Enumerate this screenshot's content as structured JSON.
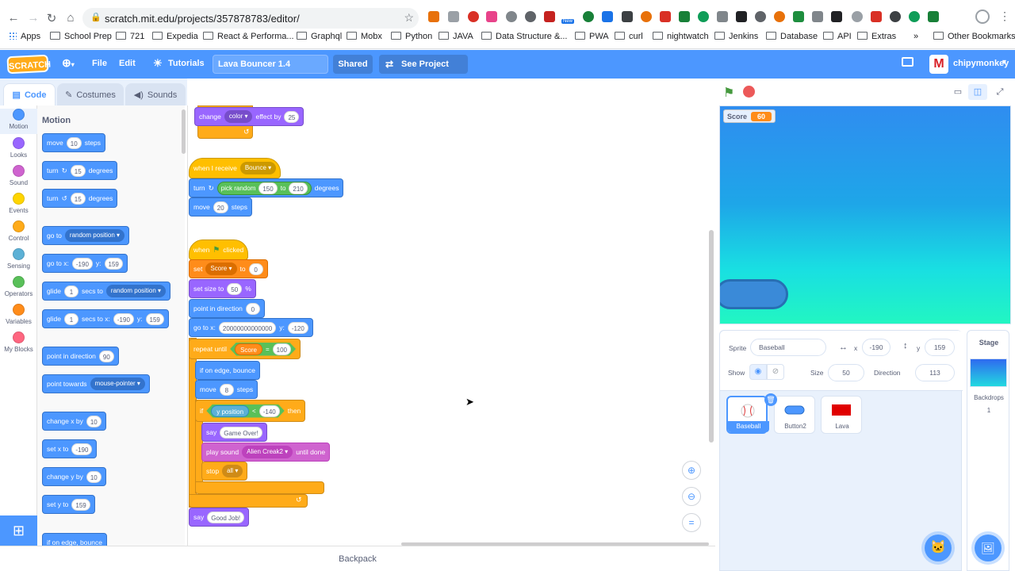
{
  "browser": {
    "url": "scratch.mit.edu/projects/357878783/editor/",
    "bookmarks": [
      "Apps",
      "School Prep",
      "721",
      "Expedia",
      "React & Performa...",
      "Graphql",
      "Mobx",
      "Python",
      "JAVA",
      "Data Structure &...",
      "PWA",
      "curl",
      "nightwatch",
      "Jenkins",
      "Database",
      "API",
      "Extras"
    ],
    "more_bookmarks": "»",
    "other_bookmarks": "Other Bookmarks",
    "new_badge": "New"
  },
  "menubar": {
    "logo": "SCRATCH",
    "file": "File",
    "edit": "Edit",
    "tutorials": "Tutorials",
    "project_title": "Lava Bouncer 1.4",
    "shared": "Shared",
    "see_project_page": "See Project Page",
    "username": "chipymonkey",
    "avatar_letter": "M"
  },
  "tabs": {
    "code": "Code",
    "costumes": "Costumes",
    "sounds": "Sounds"
  },
  "categories": [
    {
      "label": "Motion",
      "color": "#4c97ff"
    },
    {
      "label": "Looks",
      "color": "#9966ff"
    },
    {
      "label": "Sound",
      "color": "#cf63cf"
    },
    {
      "label": "Events",
      "color": "#ffd500"
    },
    {
      "label": "Control",
      "color": "#ffab19"
    },
    {
      "label": "Sensing",
      "color": "#5cb1d6"
    },
    {
      "label": "Operators",
      "color": "#59c059"
    },
    {
      "label": "Variables",
      "color": "#ff8c1a"
    },
    {
      "label": "My Blocks",
      "color": "#ff6680"
    }
  ],
  "palette": {
    "title": "Motion",
    "move": {
      "a": "move",
      "v": "10",
      "b": "steps"
    },
    "turn_right": {
      "a": "turn",
      "icon": "↻",
      "v": "15",
      "b": "degrees"
    },
    "turn_left": {
      "a": "turn",
      "icon": "↺",
      "v": "15",
      "b": "degrees"
    },
    "go_to": {
      "a": "go to",
      "d": "random position"
    },
    "go_to_xy": {
      "a": "go to x:",
      "x": "-190",
      "b": "y:",
      "y": "159"
    },
    "glide_to": {
      "a": "glide",
      "v": "1",
      "b": "secs to",
      "d": "random position"
    },
    "glide_xy": {
      "a": "glide",
      "v": "1",
      "b": "secs to x:",
      "x": "-190",
      "c": "y:",
      "y": "159"
    },
    "point_dir": {
      "a": "point in direction",
      "v": "90"
    },
    "point_towards": {
      "a": "point towards",
      "d": "mouse-pointer"
    },
    "change_x": {
      "a": "change x by",
      "v": "10"
    },
    "set_x": {
      "a": "set x to",
      "v": "-190"
    },
    "change_y": {
      "a": "change y by",
      "v": "10"
    },
    "set_y": {
      "a": "set y to",
      "v": "159"
    },
    "edge_bounce": "if on edge, bounce"
  },
  "script": {
    "change_effect": {
      "a": "change",
      "d": "color",
      "b": "effect by",
      "v": "25"
    },
    "when_receive": {
      "a": "when I receive",
      "d": "Bounce"
    },
    "turn_random": {
      "a": "turn",
      "icon": "↻",
      "op": "pick random",
      "v1": "150",
      "to": "to",
      "v2": "210",
      "b": "degrees"
    },
    "move20": {
      "a": "move",
      "v": "20",
      "b": "steps"
    },
    "when_flag": {
      "a": "when",
      "b": "clicked"
    },
    "set_score": {
      "a": "set",
      "d": "Score",
      "b": "to",
      "v": "0"
    },
    "set_size": {
      "a": "set size to",
      "v": "50",
      "b": "%"
    },
    "point_dir": {
      "a": "point in direction",
      "v": "0"
    },
    "go_to_xy": {
      "a": "go to x:",
      "x": "20000000000000",
      "b": "y:",
      "y": "-120"
    },
    "repeat_until": {
      "a": "repeat until",
      "var": "Score",
      "op": "=",
      "v": "100"
    },
    "edge_bounce": "if on edge, bounce",
    "move8": {
      "a": "move",
      "v": "8",
      "b": "steps"
    },
    "if_block": {
      "a": "if",
      "sense": "y position",
      "op": "<",
      "v": "-140",
      "b": "then"
    },
    "say_over": {
      "a": "say",
      "v": "Game Over!"
    },
    "play_sound": {
      "a": "play sound",
      "d": "Alien Creak2",
      "b": "until done"
    },
    "stop": {
      "a": "stop",
      "d": "all"
    },
    "say_good": {
      "a": "say",
      "v": "Good Job!"
    },
    "loop_arrow": "↺"
  },
  "backpack": "Backpack",
  "stage": {
    "monitor_label": "Score",
    "monitor_value": "60"
  },
  "sprite_info": {
    "sprite_label": "Sprite",
    "sprite_name": "Baseball",
    "x_label": "x",
    "x": "-190",
    "y_label": "y",
    "y": "159",
    "show_label": "Show",
    "size_label": "Size",
    "size": "50",
    "direction_label": "Direction",
    "direction": "113"
  },
  "sprites": [
    {
      "name": "Baseball",
      "selected": true
    },
    {
      "name": "Button2",
      "selected": false
    },
    {
      "name": "Lava",
      "selected": false
    }
  ],
  "stage_target": {
    "label": "Stage",
    "backdrops_label": "Backdrops",
    "backdrops_count": "1"
  }
}
